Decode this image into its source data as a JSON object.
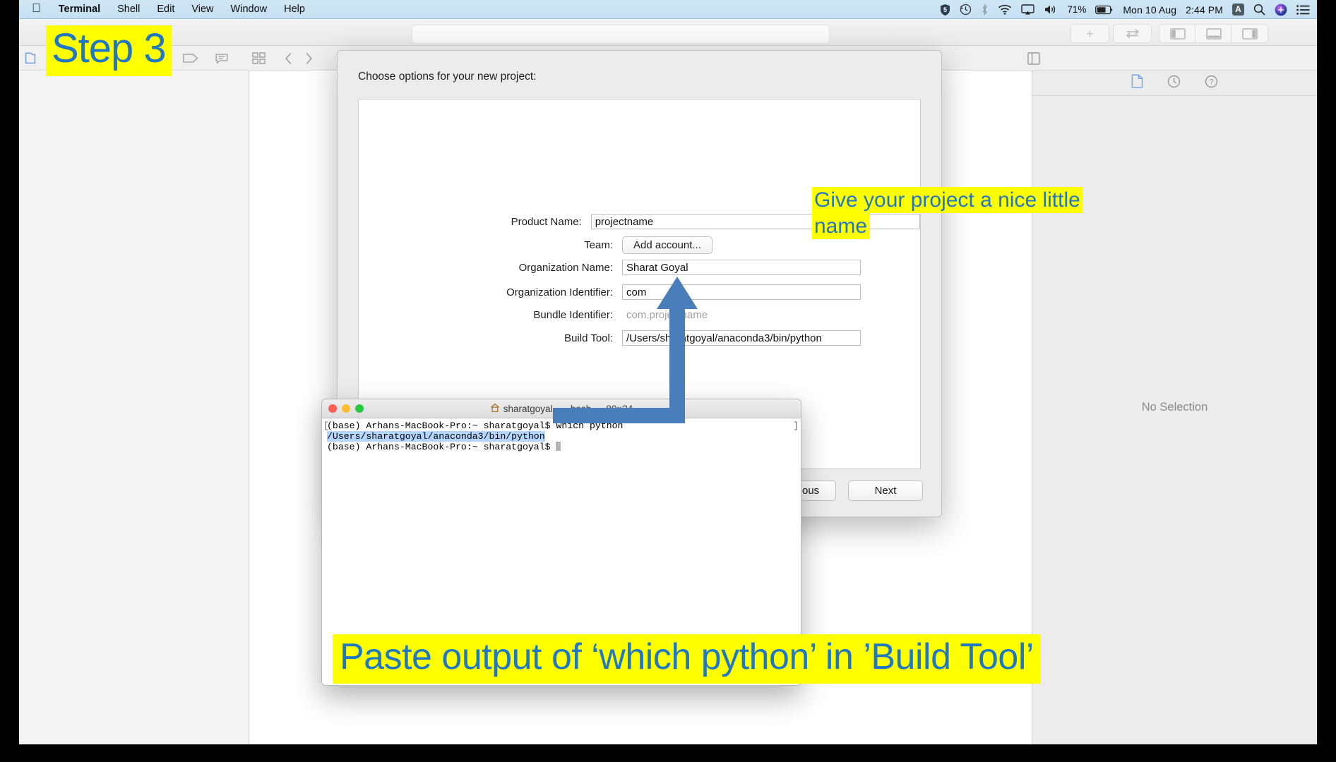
{
  "menubar": {
    "apple_icon": "apple-logo-icon",
    "items": [
      {
        "label": "Terminal",
        "bold": true
      },
      {
        "label": "Shell",
        "bold": false
      },
      {
        "label": "Edit",
        "bold": false
      },
      {
        "label": "View",
        "bold": false
      },
      {
        "label": "Window",
        "bold": false
      },
      {
        "label": "Help",
        "bold": false
      }
    ],
    "status": {
      "battery_percent": "71%",
      "date": "Mon 10 Aug",
      "time": "2:44 PM",
      "input_source": "A",
      "icons": [
        "shield-five-icon",
        "time-machine-icon",
        "bluetooth-icon",
        "wifi-icon",
        "airplay-icon",
        "volume-icon",
        "battery-icon",
        "spotlight-search-icon",
        "siri-icon",
        "notification-center-icon"
      ]
    }
  },
  "xcode": {
    "toolbar": {
      "add_label": "+",
      "icons": [
        "navigator-toggle-icon",
        "swap-arrows-icon",
        "left-panel-toggle-icon",
        "bottom-panel-toggle-icon",
        "right-panel-toggle-icon"
      ],
      "search_placeholder": ""
    },
    "subtoolbar": {
      "icons": [
        "project-navigator-icon",
        "table-icon",
        "tag-icon",
        "comment-icon",
        "grid-icon",
        "back-chevron-icon",
        "forward-chevron-icon"
      ]
    },
    "inspector": {
      "icons": [
        "file-inspector-icon",
        "history-inspector-icon",
        "help-inspector-icon"
      ],
      "selected_icon": "file-inspector-icon",
      "empty_state": "No Selection"
    }
  },
  "sheet": {
    "title": "Choose options for your new project:",
    "fields": [
      {
        "label": "Product Name:",
        "value": "projectname",
        "type": "input",
        "width": "wide"
      },
      {
        "label": "Team:",
        "value": "Add account...",
        "type": "button"
      },
      {
        "label": "Organization Name:",
        "value": "Sharat Goyal",
        "type": "input",
        "width": "mid"
      },
      {
        "label": "Organization Identifier:",
        "value": "com",
        "type": "input",
        "width": "mid"
      },
      {
        "label": "Bundle Identifier:",
        "value": "com.projectname",
        "type": "static"
      },
      {
        "label": "Build Tool:",
        "value": "/Users/sharatgoyal/anaconda3/bin/python",
        "type": "input",
        "width": "mid"
      }
    ],
    "buttons": [
      {
        "label": "Previous"
      },
      {
        "label": "Next"
      }
    ]
  },
  "terminal": {
    "title": "sharatgoyal — -bash — 80×24",
    "home_icon": "home-folder-icon",
    "lines": [
      {
        "text": "(base) Arhans-MacBook-Pro:~ sharatgoyal$ which python",
        "selected": false
      },
      {
        "text": "/Users/sharatgoyal/anaconda3/bin/python",
        "selected": true
      },
      {
        "text": "(base) Arhans-MacBook-Pro:~ sharatgoyal$ ",
        "selected": false,
        "cursor": true
      }
    ],
    "left_bracket": "[",
    "right_bracket": "]"
  },
  "annotations": {
    "step": "Step 3",
    "name_hint": "Give your project a nice little name",
    "paste_hint": "Paste output of ‘which python’ in ’Build Tool’",
    "arrow": "blue-up-arrow",
    "highlight_color": "#ffff00",
    "text_color": "#1f78c1",
    "arrow_color": "#4a7ebb"
  }
}
